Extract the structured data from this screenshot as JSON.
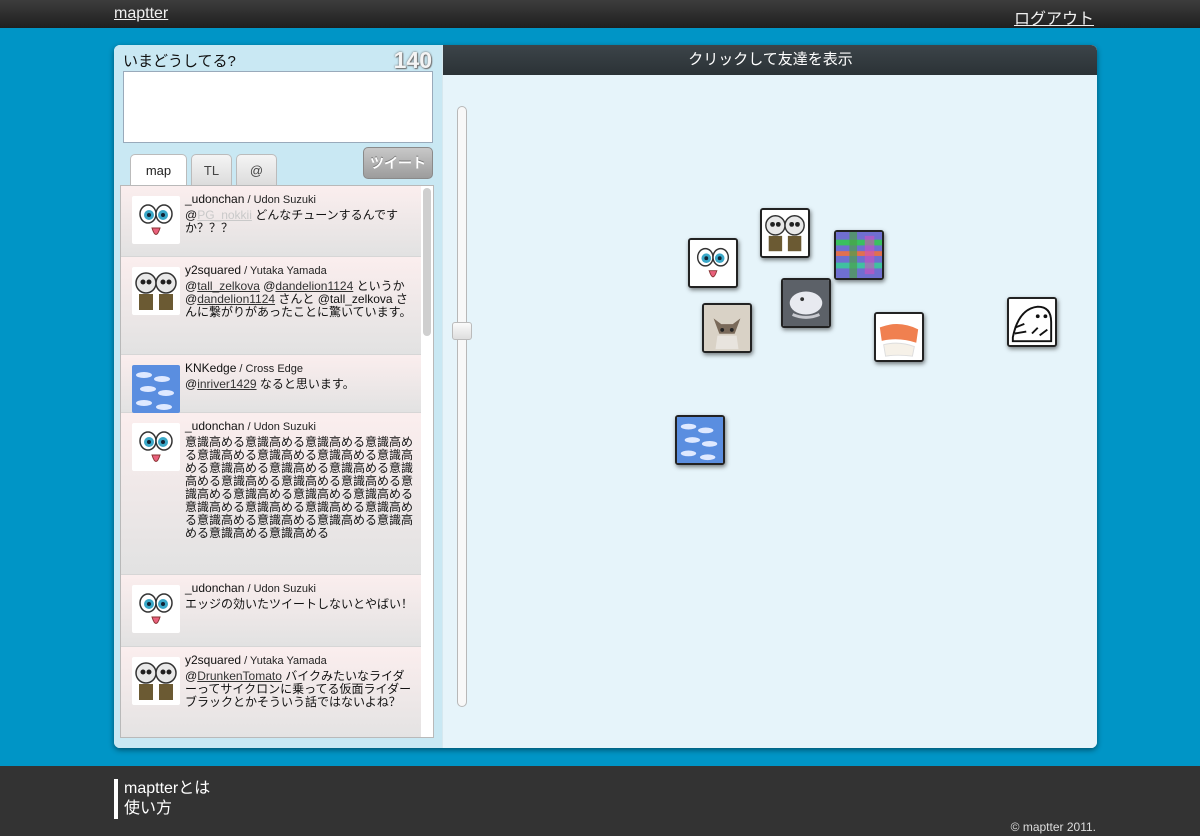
{
  "header": {
    "brand": "maptter",
    "logout": "ログアウト"
  },
  "compose": {
    "prompt": "いまどうしてる?",
    "counter": "140",
    "placeholder": "",
    "button_label": "ツイート"
  },
  "tabs": [
    {
      "label": "map"
    },
    {
      "label": "TL"
    },
    {
      "label": "@"
    }
  ],
  "timeline": [
    {
      "screen_name": "_udonchan",
      "name": "Udon Suzuki",
      "avatar": "udon-icon",
      "at": "@",
      "mention1": "PG_nokkii",
      "mid1": " どんなチューンするんですか？？？",
      "mention2": "",
      "mid2": "",
      "mention3": "",
      "tail": ""
    },
    {
      "screen_name": "y2squared",
      "name": "Yutaka Yamada",
      "avatar": "cats-icon",
      "at": "@",
      "mention1": "tall_zelkova",
      "mid1": " @",
      "mention2": "dandelion1124",
      "mid2": " というか@",
      "mention3": "dandelion1124",
      "tail": " さんと @tall_zelkova さんに繋がりがあったことに驚いています。"
    },
    {
      "screen_name": "KNKedge",
      "name": "Cross Edge",
      "avatar": "fish-icon",
      "at": "@",
      "mention1": "inriver1429",
      "mid1": " なると思います。",
      "mention2": "",
      "mid2": "",
      "mention3": "",
      "tail": ""
    },
    {
      "screen_name": "_udonchan",
      "name": "Udon Suzuki",
      "avatar": "udon-icon",
      "text": "意識高める意識高める意識高める意識高める意識高める意識高める意識高める意識高める意識高める意識高める意識高める意識高める意識高める意識高める意識高める意識高める意識高める意識高める意識高める意識高める意識高める意識高める意識高める意識高める意識高める意識高める意識高める意識高める意識高める"
    },
    {
      "screen_name": "_udonchan",
      "name": "Udon Suzuki",
      "avatar": "udon-icon",
      "text": "エッジの効いたツイートしないとやばい！"
    },
    {
      "screen_name": "y2squared",
      "name": "Yutaka Yamada",
      "avatar": "cats-icon",
      "at": "@",
      "mention1": "DrunkenTomato",
      "mid1": " バイクみたいなライダーってサイクロンに乗ってる仮面ライダーブラックとかそういう話ではないよね？"
    }
  ],
  "map": {
    "header": "クリックして友達を表示",
    "zoom_level": 0.63,
    "pins": [
      {
        "name": "pin-udon",
        "icon": "udon-icon"
      },
      {
        "name": "pin-cats",
        "icon": "cats-icon"
      },
      {
        "name": "pin-colorful",
        "icon": "colorful-icon"
      },
      {
        "name": "pin-cat-drawing",
        "icon": "cat-drawing-icon"
      },
      {
        "name": "pin-white-creature",
        "icon": "white-creature-icon"
      },
      {
        "name": "pin-sushi",
        "icon": "sushi-icon"
      },
      {
        "name": "pin-seal",
        "icon": "seal-icon"
      },
      {
        "name": "pin-fish",
        "icon": "fish-icon"
      }
    ]
  },
  "footer": {
    "about": "maptterとは",
    "howto": "使い方",
    "copyright": "© maptter 2011."
  }
}
